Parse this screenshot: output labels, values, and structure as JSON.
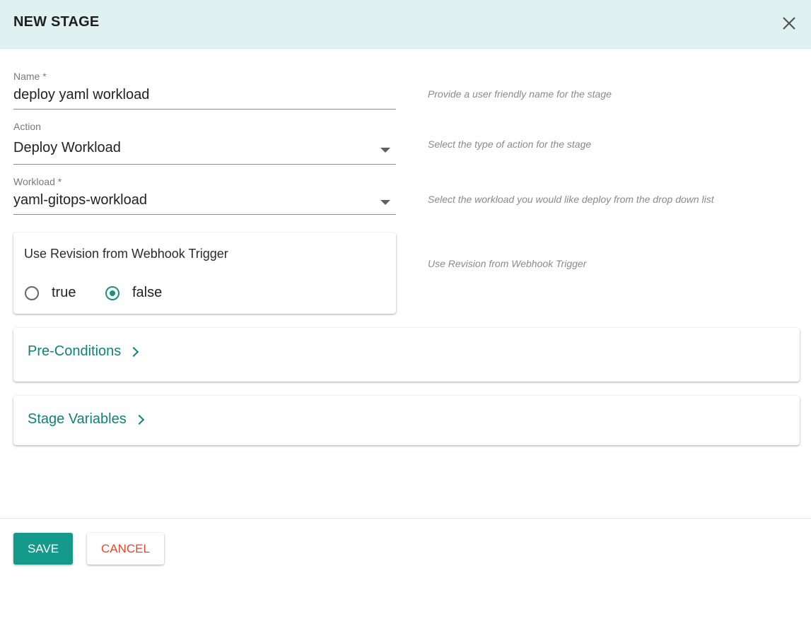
{
  "dialog": {
    "title": "NEW STAGE",
    "close_icon": "close-icon"
  },
  "form": {
    "name": {
      "label": "Name *",
      "value": "deploy yaml workload",
      "hint": "Provide a user friendly name for the stage"
    },
    "action": {
      "label": "Action",
      "value": "Deploy Workload",
      "hint": "Select the type of action for the stage",
      "icon": "dropdown-arrow-icon"
    },
    "workload": {
      "label": "Workload *",
      "value": "yaml-gitops-workload",
      "hint": "Select the workload you would like deploy from the drop down list",
      "icon": "dropdown-arrow-icon"
    },
    "revision": {
      "title": "Use Revision from Webhook Trigger",
      "hint": "Use Revision from Webhook Trigger",
      "options": [
        {
          "label": "true",
          "selected": false
        },
        {
          "label": "false",
          "selected": true
        }
      ]
    }
  },
  "sections": {
    "pre_conditions": {
      "label": "Pre-Conditions",
      "icon": "chevron-right-icon"
    },
    "stage_variables": {
      "label": "Stage Variables",
      "icon": "chevron-right-icon"
    }
  },
  "footer": {
    "save_label": "SAVE",
    "cancel_label": "CANCEL"
  },
  "colors": {
    "header_bg": "#dff1f0",
    "accent": "#14998b",
    "section_title": "#137f7a",
    "cancel_text": "#e2462c"
  }
}
